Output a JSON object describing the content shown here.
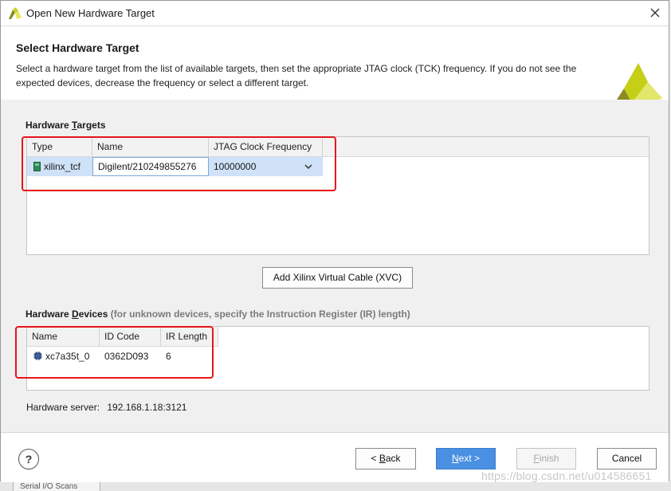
{
  "window": {
    "title": "Open New Hardware Target"
  },
  "header": {
    "title": "Select Hardware Target",
    "description": "Select a hardware target from the list of available targets, then set the appropriate JTAG clock (TCK) frequency. If you do not see the expected devices, decrease the frequency or select a different target."
  },
  "hardware_targets": {
    "label_prefix": "Hardware ",
    "label_underlined": "T",
    "label_suffix": "argets",
    "columns": [
      "Type",
      "Name",
      "JTAG Clock Frequency"
    ],
    "rows": [
      {
        "type": "xilinx_tcf",
        "name": "Digilent/210249855276",
        "frequency": "10000000"
      }
    ]
  },
  "add_xvc_button": "Add Xilinx Virtual Cable (XVC)",
  "hardware_devices": {
    "label_prefix": "Hardware ",
    "label_underlined": "D",
    "label_suffix": "evices",
    "hint": "(for unknown devices, specify the Instruction Register (IR) length)",
    "columns": [
      "Name",
      "ID Code",
      "IR Length"
    ],
    "rows": [
      {
        "name": "xc7a35t_0",
        "id_code": "0362D093",
        "ir_length": "6"
      }
    ]
  },
  "server": {
    "label": "Hardware server:",
    "value": "192.168.1.18:3121"
  },
  "footer": {
    "help": "?",
    "back_prefix": "< ",
    "back_u": "B",
    "back_rest": "ack",
    "next_u": "N",
    "next_rest": "ext >",
    "finish_u": "F",
    "finish_rest": "inish",
    "cancel": "Cancel"
  },
  "background": {
    "tab_label": "Serial I/O Scans"
  },
  "watermark": "https://blog.csdn.net/u014586651",
  "colors": {
    "primary_button": "#4a90e2",
    "annotation_red": "#e8141b",
    "selected_row": "#cfe2f8"
  }
}
